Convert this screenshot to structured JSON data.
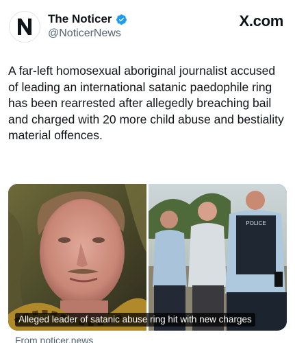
{
  "account": {
    "display_name": "The Noticer",
    "handle": "@NoticerNews",
    "avatar_letter": "N",
    "verified_icon": "verified-badge-icon",
    "verified_color": "#1d9bf0"
  },
  "site_label": "X.com",
  "tweet": {
    "text": "A far-left homosexual aboriginal journalist accused of leading an international satanic paedophile ring has been rearrested after allegedly breaching bail and charged with 20 more child abuse and bestiality material offences."
  },
  "media": {
    "caption": "Alleged leader of satanic abuse ring hit with new charges",
    "police_vest_text": "POLICE"
  },
  "card_source": "From noticer.news"
}
